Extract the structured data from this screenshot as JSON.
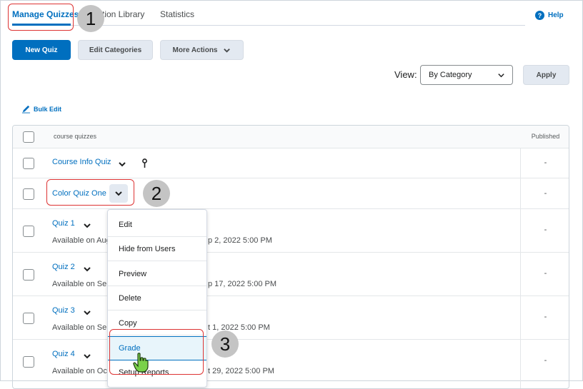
{
  "tabs": [
    {
      "label": "Manage Quizzes"
    },
    {
      "label": "tion Library"
    },
    {
      "label": "Statistics"
    }
  ],
  "help_label": "Help",
  "toolbar": {
    "new_quiz": "New Quiz",
    "edit_categories": "Edit Categories",
    "more_actions": "More Actions"
  },
  "view": {
    "label": "View:",
    "selected": "By Category",
    "apply": "Apply"
  },
  "bulk_edit": "Bulk Edit",
  "table": {
    "header_name": "course quizzes",
    "header_published": "Published",
    "rows": [
      {
        "name": "Course Info Quiz",
        "published": "-"
      },
      {
        "name": "Color Quiz One",
        "published": "-"
      },
      {
        "name": "Quiz 1",
        "avail_start": "Available on Aug",
        "avail_end": "p 2, 2022 5:00 PM",
        "published": "-"
      },
      {
        "name": "Quiz 2",
        "avail_start": "Available on Sep",
        "avail_end": "p 17, 2022 5:00 PM",
        "published": "-"
      },
      {
        "name": "Quiz 3",
        "avail_start": "Available on Sep",
        "avail_end": "t 1, 2022 5:00 PM",
        "published": "-"
      },
      {
        "name": "Quiz 4",
        "avail_start": "Available on Oct",
        "avail_end": "t 29, 2022 5:00 PM",
        "published": "-"
      }
    ]
  },
  "menu": {
    "items": [
      "Edit",
      "Hide from Users",
      "Preview",
      "Delete",
      "Copy",
      "Grade",
      "Setup Reports"
    ]
  },
  "annotations": [
    "1",
    "2",
    "3"
  ],
  "colors": {
    "accent": "#006fbf",
    "annotation": "#dd3333"
  }
}
